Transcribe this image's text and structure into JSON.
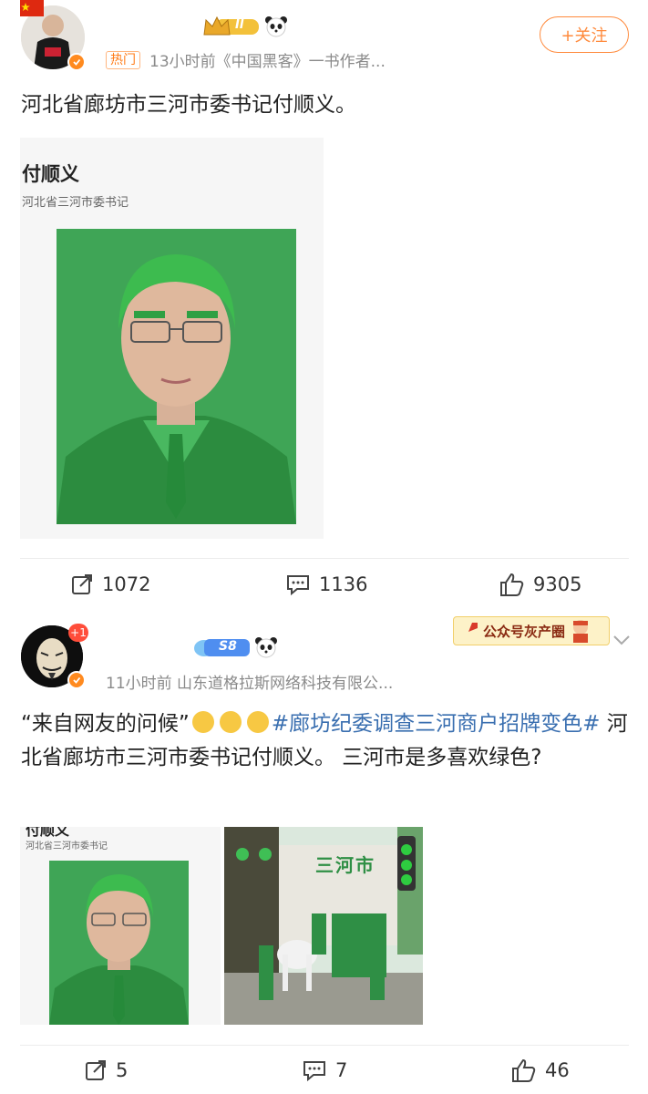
{
  "post1": {
    "hot_tag": "热门",
    "meta": "13小时前《中国黑客》一书作者...",
    "level_badge": "II",
    "follow_label": "+关注",
    "text": "河北省廊坊市三河市委书记付顺义。",
    "image": {
      "name_caption": "付顺义",
      "title_caption": "河北省三河市委书记"
    },
    "actions": {
      "share": "1072",
      "comment": "1136",
      "like": "9305"
    }
  },
  "post2": {
    "avatar_badge": "+1",
    "level_badge": "S8",
    "meta": "11小时前  山东道格拉斯网络科技有限公...",
    "ad_banner": "公众号灰产圈",
    "text_quote": "“来自网友的问候”",
    "topic": "#廊坊纪委调查三河商户招牌变色#",
    "text_rest": "河北省廊坊市三河市委书记付顺义。 三河市是多喜欢绿色?",
    "image1": {
      "name_caption": "付顺义",
      "title_caption": "河北省三河市委书记"
    },
    "image2": {
      "sign_text": "三河市"
    },
    "actions": {
      "share": "5",
      "comment": "7",
      "like": "46"
    }
  },
  "colors": {
    "accent": "#ff8a3c",
    "topic": "#3a6fb0",
    "green": "#2fa84f"
  },
  "icons": [
    "flag-icon",
    "crown-badge-icon",
    "panda-icon",
    "verified-icon",
    "share-icon",
    "comment-icon",
    "like-icon",
    "cloud-badge-icon",
    "chevron-down-icon",
    "sweat-emoji-icon"
  ]
}
